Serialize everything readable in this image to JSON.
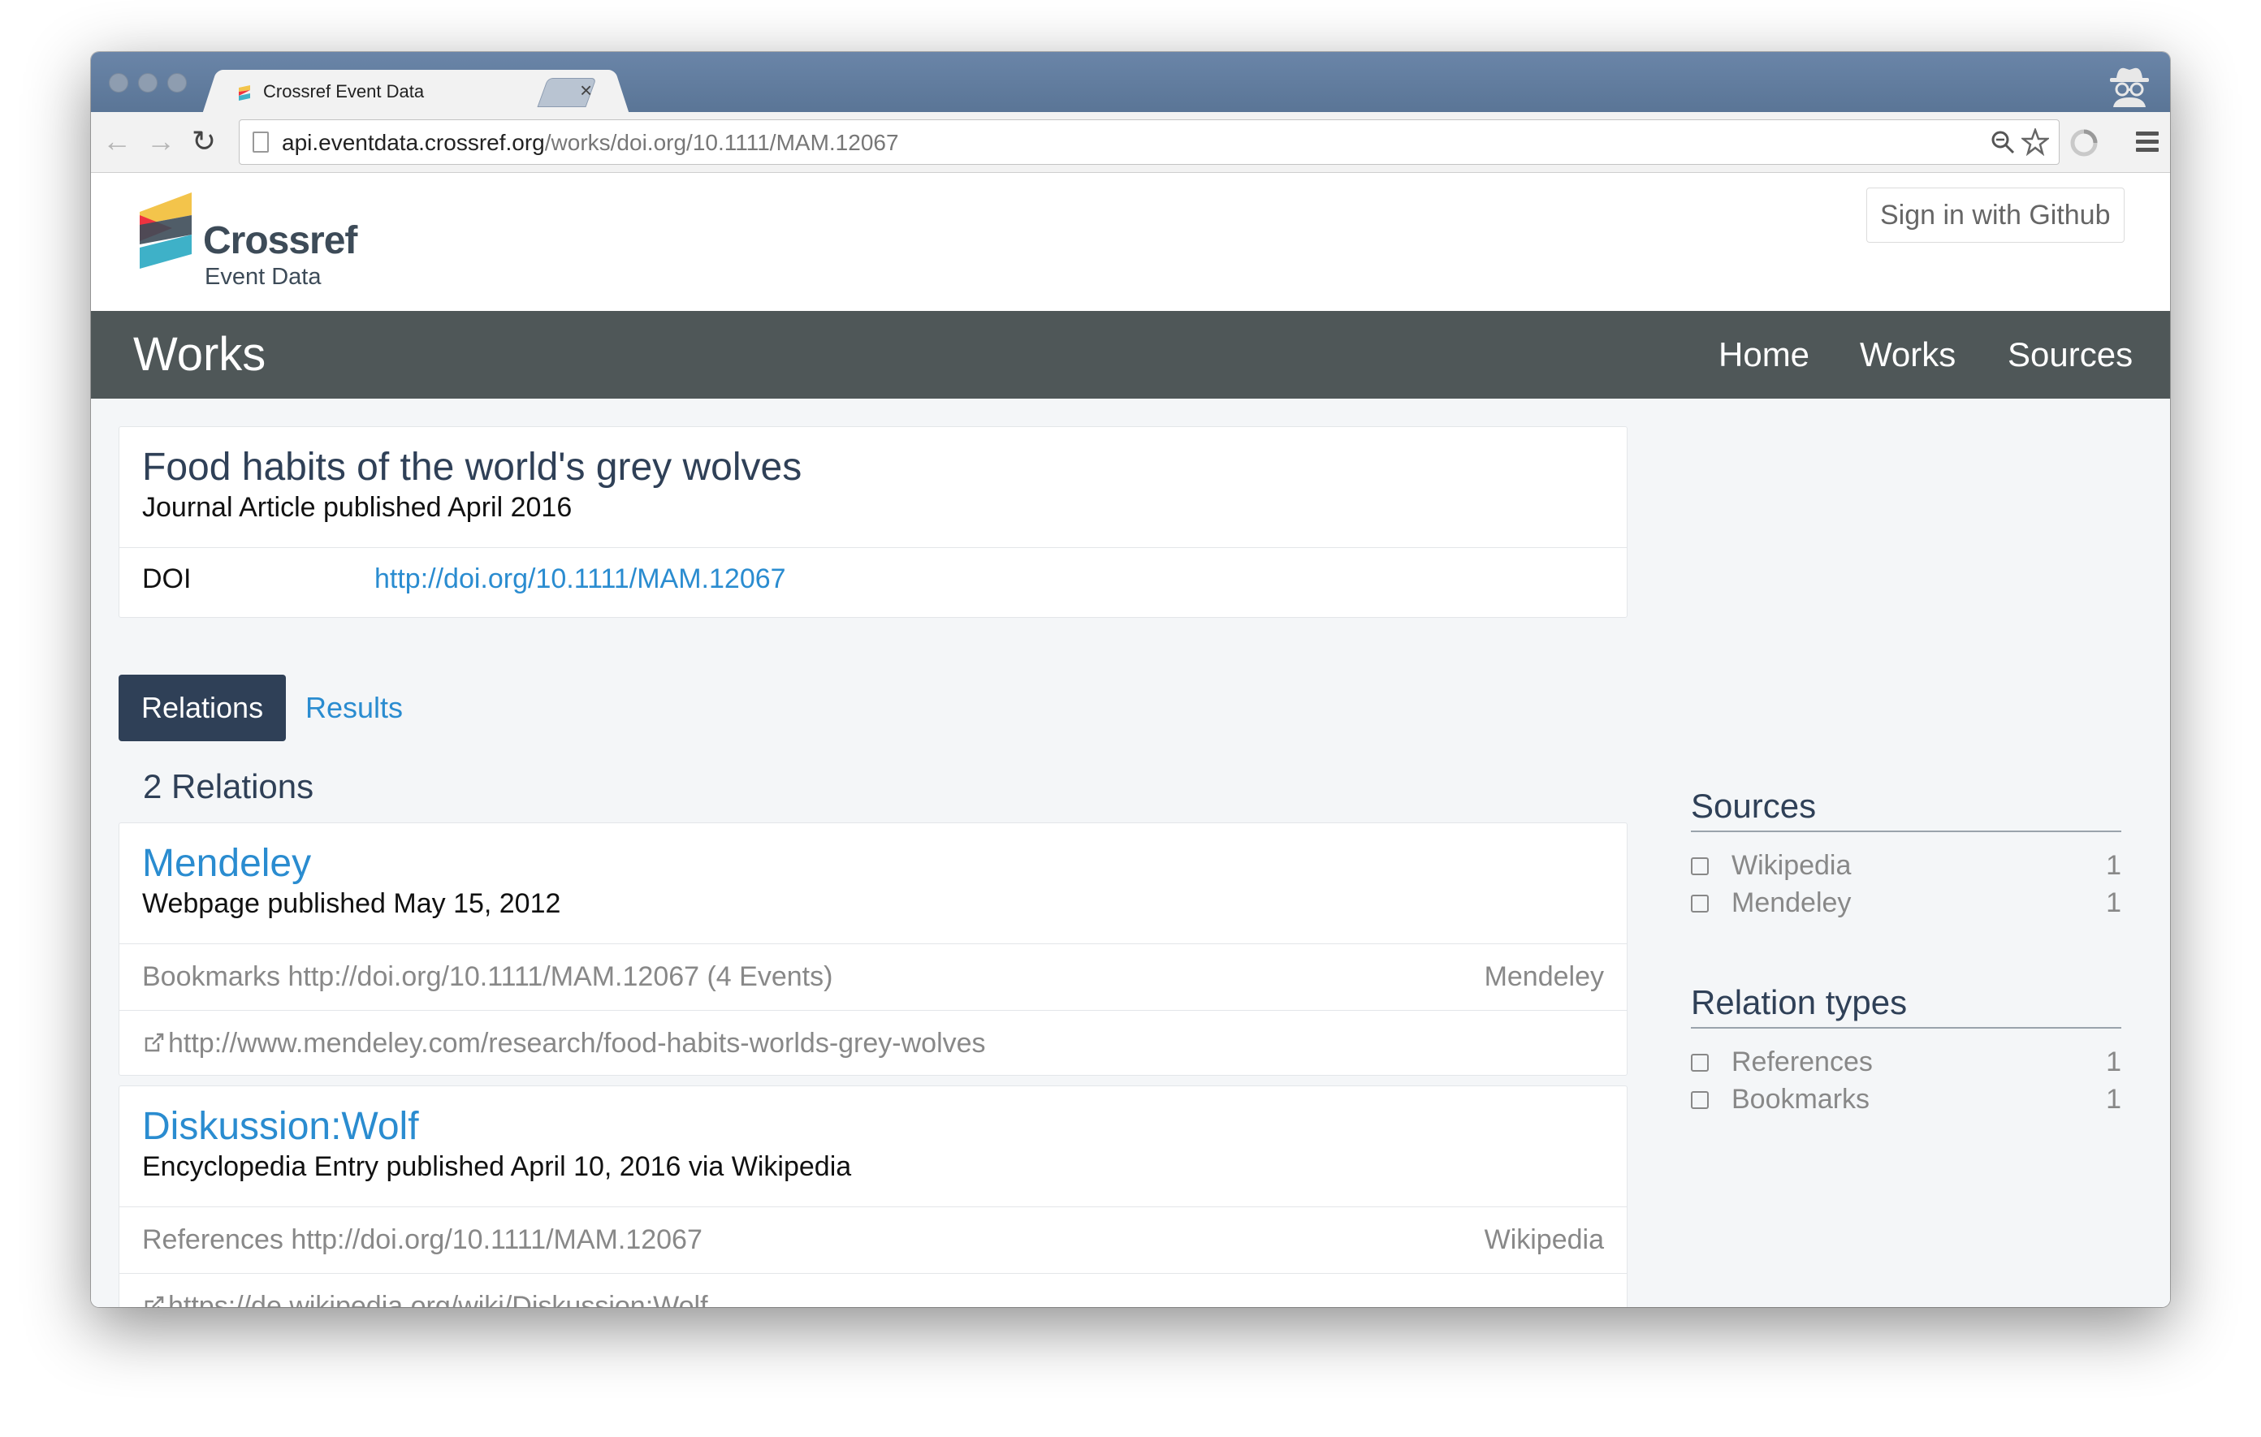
{
  "browser": {
    "tab_title": "Crossref Event Data",
    "tab_close": "×",
    "url_host": "api.eventdata.crossref.org",
    "url_path": "/works/doi.org/10.1111/MAM.12067",
    "icons": [
      "back-icon",
      "forward-icon",
      "reload-icon",
      "page-icon",
      "zoom-icon",
      "star-icon",
      "extension-icon",
      "menu-icon",
      "incognito-icon"
    ]
  },
  "site": {
    "logo_name": "Crossref",
    "logo_sub": "Event Data",
    "signin_label": "Sign in with Github"
  },
  "navbar": {
    "title": "Works",
    "links": [
      "Home",
      "Works",
      "Sources"
    ]
  },
  "work": {
    "title": "Food habits of the world's grey wolves",
    "subtitle": "Journal Article published April 2016",
    "doi_label": "DOI",
    "doi_link": "http://doi.org/10.1111/MAM.12067"
  },
  "tabs": {
    "relations": "Relations",
    "results": "Results"
  },
  "relations": {
    "count_label": "2 Relations",
    "items": [
      {
        "title": "Mendeley",
        "subtitle": "Webpage published May 15, 2012",
        "description": "Bookmarks http://doi.org/10.1111/MAM.12067 (4 Events)",
        "source": "Mendeley",
        "url": "http://www.mendeley.com/research/food-habits-worlds-grey-wolves"
      },
      {
        "title": "Diskussion:Wolf",
        "subtitle": "Encyclopedia Entry published April 10, 2016 via Wikipedia",
        "description": "References http://doi.org/10.1111/MAM.12067",
        "source": "Wikipedia",
        "url": "https://de.wikipedia.org/wiki/Diskussion:Wolf"
      }
    ]
  },
  "sidebar": {
    "sources_heading": "Sources",
    "sources": [
      {
        "label": "Wikipedia",
        "count": "1"
      },
      {
        "label": "Mendeley",
        "count": "1"
      }
    ],
    "relation_types_heading": "Relation types",
    "relation_types": [
      {
        "label": "References",
        "count": "1"
      },
      {
        "label": "Bookmarks",
        "count": "1"
      }
    ]
  },
  "colors": {
    "navbar": "#4f5758",
    "accent_link": "#2a8cd0",
    "tab_active": "#2f4057",
    "title_text": "#2f4057"
  }
}
